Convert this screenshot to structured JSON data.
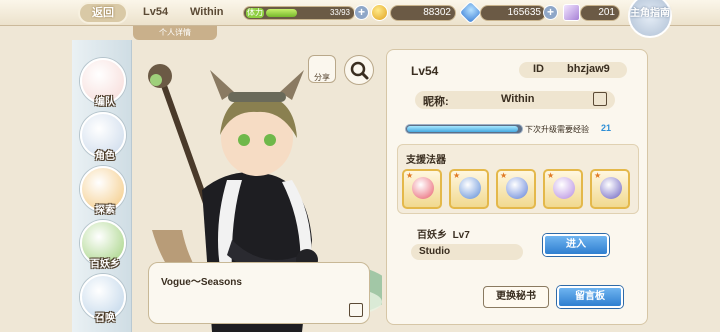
{
  "topbar": {
    "back_label": "返回",
    "level": "Lv54",
    "name": "Within",
    "stamina_tag": "体力",
    "stamina": "33/93",
    "stamina_ratio": 0.35,
    "gold": "88302",
    "gems": "165635",
    "tickets": "201",
    "guide_label": "主角指南"
  },
  "subtab": "个人详情",
  "sidenav": [
    {
      "label": "编队",
      "color": "#f6d9d6"
    },
    {
      "label": "角色",
      "color": "#c9d8ea"
    },
    {
      "label": "探索",
      "color": "#f3c77d"
    },
    {
      "label": "百妖乡",
      "color": "#9fd07b"
    },
    {
      "label": "召唤",
      "color": "#bcd3e8"
    }
  ],
  "share_label": "分享",
  "quote": "Vogue～Seasons",
  "profile": {
    "level": "Lv54",
    "id_label": "ID",
    "id_value": "bhzjaw9",
    "nick_label": "昵称:",
    "nick_value": "Within",
    "exp_ratio": 0.97,
    "exp_text": "下次升级需要经验",
    "exp_value": "21"
  },
  "support": {
    "title": "支援法器",
    "slots": [
      {
        "icon": "red-crystal-wing-icon",
        "color": "#e85c6c"
      },
      {
        "icon": "trident-icon",
        "color": "#5a8ad6"
      },
      {
        "icon": "blue-spirit-mask-icon",
        "color": "#5e7fd8"
      },
      {
        "icon": "purple-orb-icon",
        "color": "#b48ae0"
      },
      {
        "icon": "star-crystal-icon",
        "color": "#6a5fc0"
      }
    ]
  },
  "village": {
    "label": "百妖乡",
    "level": "Lv7",
    "name": "Studio",
    "enter_label": "进入"
  },
  "buttons": {
    "change_secretary": "更换秘书",
    "message_board": "留言板"
  }
}
